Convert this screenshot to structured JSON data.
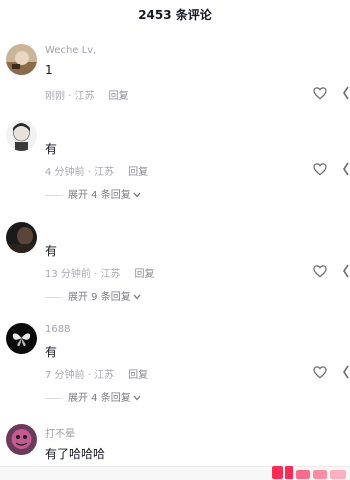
{
  "header": {
    "title": "2453 条评论"
  },
  "comments": [
    {
      "username": "Weche Lv,",
      "content": "1",
      "time_location": "刚刚 · 江苏",
      "reply_label": "回复"
    },
    {
      "username": "",
      "content": "有",
      "time_location": "4 分钟前 · 江苏",
      "reply_label": "回复",
      "expand_label": "展开 4 条回复"
    },
    {
      "username": "",
      "content": "有",
      "time_location": "13 分钟前 · 江苏",
      "reply_label": "回复",
      "expand_label": "展开 9 条回复"
    },
    {
      "username": "1688",
      "content": "有",
      "time_location": "7 分钟前 · 江苏",
      "reply_label": "回复",
      "expand_label": "展开 4 条回复"
    },
    {
      "username": "打不晕",
      "content": "有了哈哈哈"
    }
  ],
  "icons": {
    "like": "heart-outline-icon",
    "more": "more-icon",
    "expand": "chevron-down-icon"
  },
  "colors": {
    "text_primary": "#161823",
    "text_secondary": "#a8a8b0",
    "watermark": "#fe2c55"
  }
}
